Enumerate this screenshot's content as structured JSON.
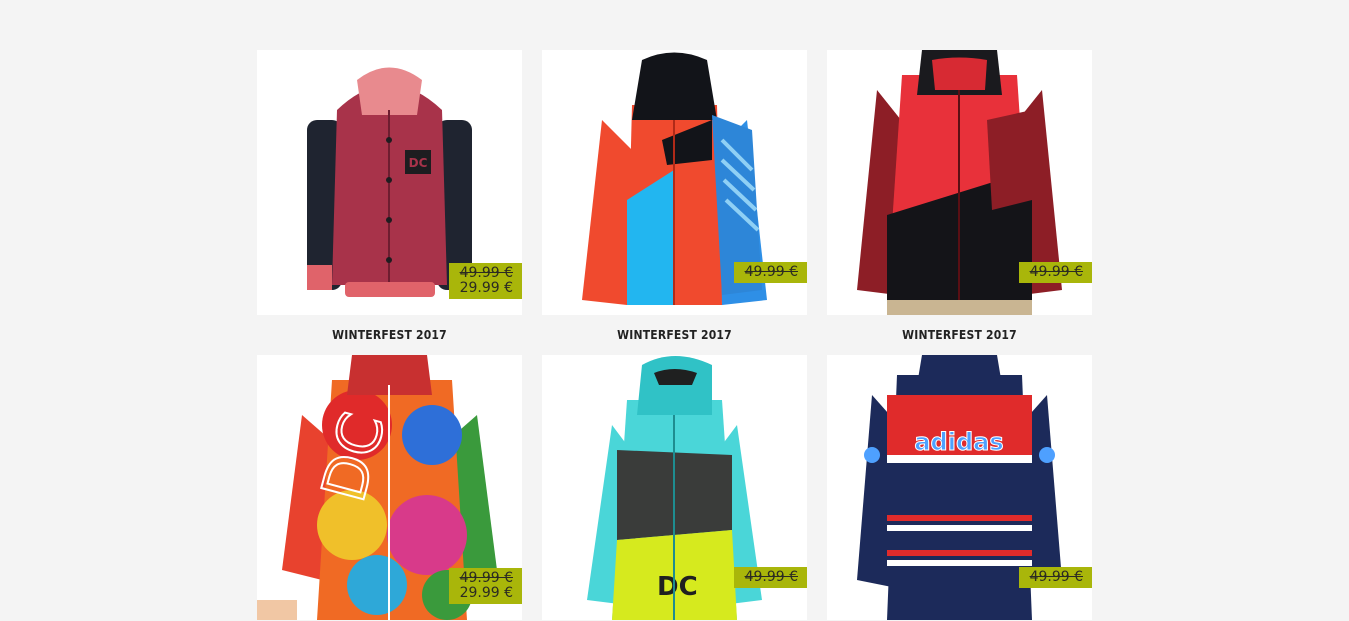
{
  "products": [
    {
      "title": "WINTERFEST 2017",
      "old_price": "49.99 €",
      "new_price": "29.99 €",
      "image": "dc-womens-maroon-jacket"
    },
    {
      "title": "WINTERFEST 2017",
      "old_price": "49.99 €",
      "new_price": "",
      "image": "volcom-red-blue-jacket"
    },
    {
      "title": "WINTERFEST 2017",
      "old_price": "49.99 €",
      "new_price": "",
      "image": "red-black-hooded-jacket"
    },
    {
      "title": "",
      "old_price": "49.99 €",
      "new_price": "29.99 €",
      "image": "tie-dye-dc-jacket"
    },
    {
      "title": "",
      "old_price": "49.99 €",
      "new_price": "",
      "image": "dc-aqua-lime-jacket"
    },
    {
      "title": "",
      "old_price": "49.99 €",
      "new_price": "",
      "image": "adidas-navy-red-anorak"
    }
  ],
  "colors": {
    "page_bg": "#f4f4f4",
    "price_badge": "#a9b60a"
  }
}
